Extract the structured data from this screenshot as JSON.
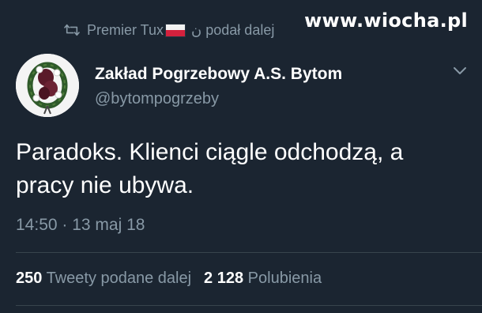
{
  "retweet": {
    "user": "Premier Tux",
    "suffix": "ن podał dalej"
  },
  "watermark": "www.wiocha.pl",
  "author": {
    "display_name": "Zakład Pogrzebowy A.S. Bytom",
    "handle": "@bytompogrzeby",
    "avatar_icon": "wreath-avatar"
  },
  "tweet": {
    "text": "Paradoks. Klienci ciągle odchodzą, a pracy nie ubywa.",
    "timestamp": "14:50 · 13 maj 18"
  },
  "stats": {
    "retweets_count": "250",
    "retweets_label": "Tweety podane dalej",
    "likes_count": "2 128",
    "likes_label": "Polubienia"
  },
  "colors": {
    "background": "#1b2531",
    "secondary_text": "#8899a6",
    "divider": "#38444d",
    "flag_red": "#d4213d"
  }
}
